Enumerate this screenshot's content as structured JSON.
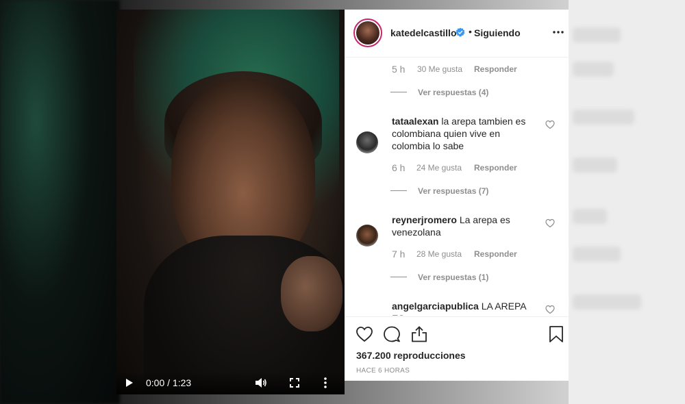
{
  "header": {
    "username": "katedelcastillo",
    "separator": "•",
    "follow_status": "Siguiendo"
  },
  "video": {
    "time_display": "0:00 / 1:23"
  },
  "comments": [
    {
      "time": "5 h",
      "likes": "30 Me gusta",
      "reply": "Responder",
      "view_replies": "Ver respuestas (4)"
    },
    {
      "username": "tataalexan",
      "text": "la arepa tambien es colombiana quien vive en colombia lo sabe",
      "time": "6 h",
      "likes": "24 Me gusta",
      "reply": "Responder",
      "view_replies": "Ver respuestas (7)"
    },
    {
      "username": "reynerjromero",
      "text": "La arepa es venezolana",
      "time": "7 h",
      "likes": "28 Me gusta",
      "reply": "Responder",
      "view_replies": "Ver respuestas (1)"
    },
    {
      "username": "angelgarciapublica",
      "text": "LA AREPA ES"
    }
  ],
  "stats": {
    "views": "367.200 reproducciones",
    "posted": "HACE 6 HORAS"
  },
  "colors": {
    "verified": "#3897f0",
    "story_ring": "#c6256b",
    "muted_text": "#8e8e8e"
  },
  "icons": [
    "play-icon",
    "volume-icon",
    "fullscreen-icon",
    "kebab-icon",
    "verified-icon",
    "more-options-icon",
    "heart-icon",
    "comment-icon",
    "share-icon",
    "bookmark-icon"
  ]
}
